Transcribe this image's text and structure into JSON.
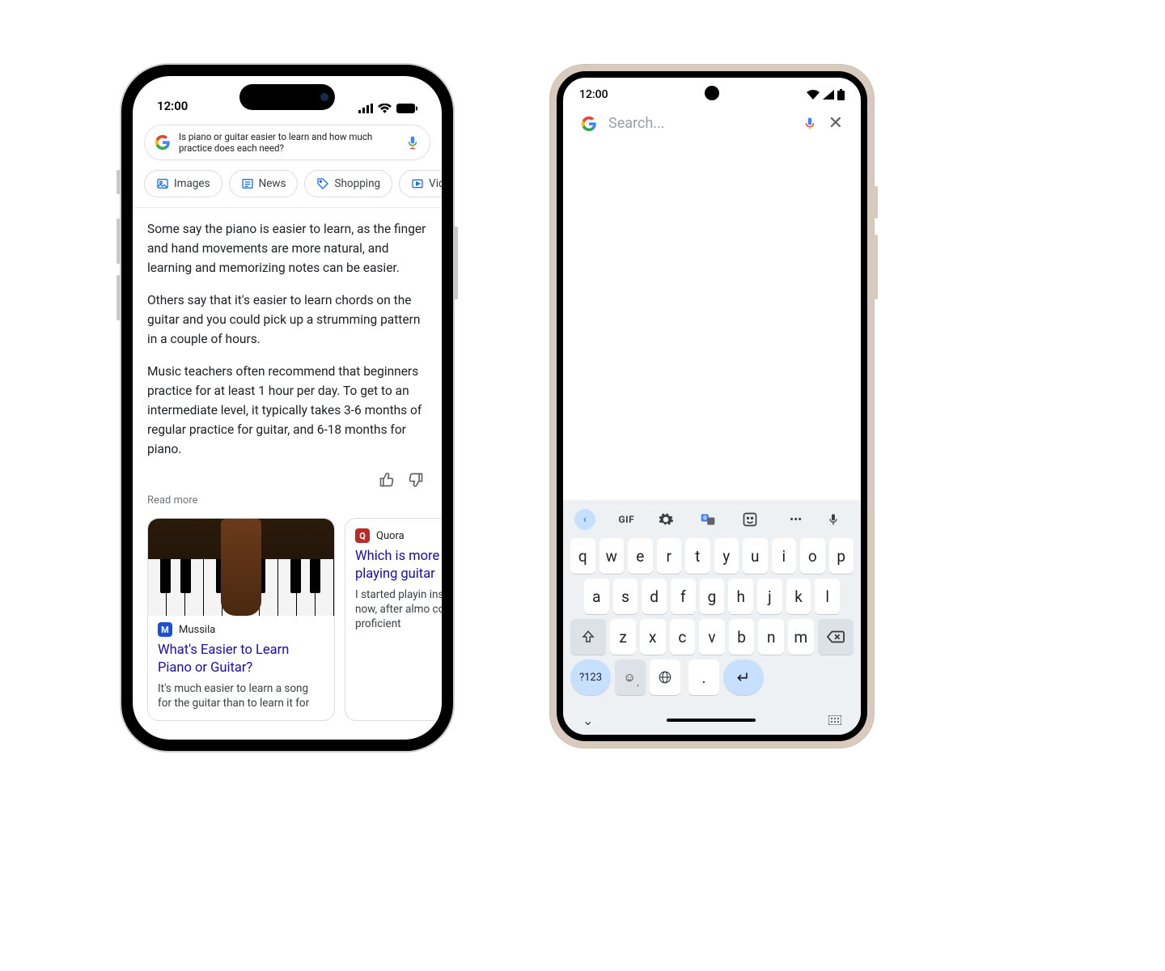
{
  "ios": {
    "status_time": "12:00",
    "search_query": "Is piano or guitar easier to learn and how much practice does each need?",
    "chips": [
      "Images",
      "News",
      "Shopping",
      "Vide"
    ],
    "answer_paragraphs": [
      "Some say the piano is easier to learn, as the finger and hand movements are more natural, and learning and memorizing notes can be easier.",
      "Others say that it's easier to learn chords on the guitar and you could pick up a strumming pattern in a couple of hours.",
      "Music teachers often recommend that beginners practice for at least 1 hour per day. To get to an intermediate level, it typically takes 3-6 months of regular practice for guitar, and 6-18 months for piano."
    ],
    "read_more": "Read more",
    "cards": [
      {
        "source": "Mussila",
        "fav_letter": "M",
        "title": "What's Easier to Learn Piano or Guitar?",
        "snippet": "It's much easier to learn a song for the guitar than to learn it for"
      },
      {
        "source": "Quora",
        "fav_letter": "Q",
        "title": "Which is more playing piano playing guitar",
        "snippet": "I started playin instruments th now, after almo continue to de proficient"
      }
    ]
  },
  "px": {
    "status_time": "12:00",
    "search_placeholder": "Search...",
    "kbd_toolbar": {
      "gif": "GIF",
      "more": "•••"
    },
    "keys_r1": [
      "q",
      "w",
      "e",
      "r",
      "t",
      "y",
      "u",
      "i",
      "o",
      "p"
    ],
    "keys_r2": [
      "a",
      "s",
      "d",
      "f",
      "g",
      "h",
      "j",
      "k",
      "l"
    ],
    "keys_r3": [
      "z",
      "x",
      "c",
      "v",
      "b",
      "n",
      "m"
    ],
    "sym_key": "?123",
    "dot_key": "."
  }
}
